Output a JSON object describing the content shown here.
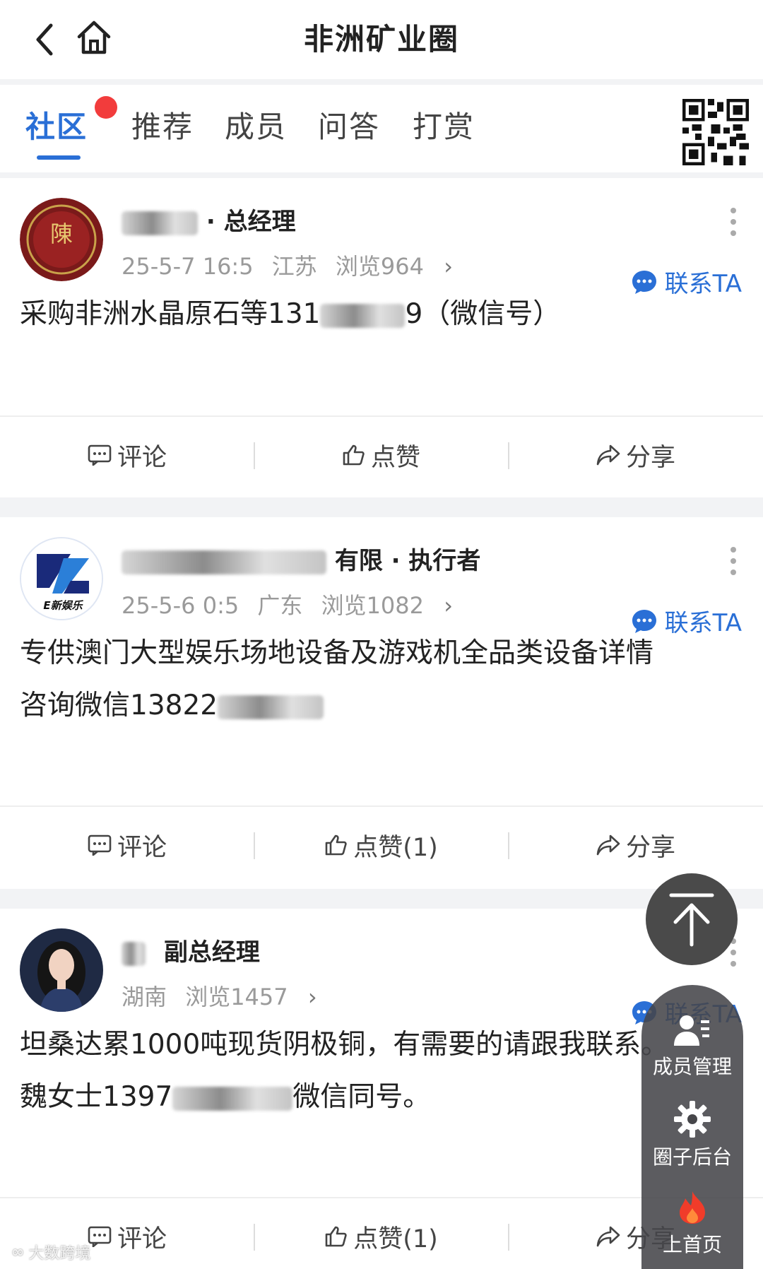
{
  "header": {
    "title": "非洲矿业圈"
  },
  "tabs": [
    {
      "label": "社区",
      "active": true
    },
    {
      "label": "推荐"
    },
    {
      "label": "成员"
    },
    {
      "label": "问答"
    },
    {
      "label": "打赏"
    }
  ],
  "posts": [
    {
      "author_role": "· 总经理",
      "meta_time": "25-5-7 16:5",
      "meta_location": "江苏",
      "meta_views": "浏览964",
      "contact_label": "联系TA",
      "content_prefix": "采购非洲水晶原石等131",
      "content_suffix": "9（微信号）",
      "actions": {
        "comment": "评论",
        "like": "点赞",
        "share": "分享"
      },
      "avatar_text": "陳"
    },
    {
      "author_role": "有限 · 执行者",
      "meta_time": "25-5-6 0:5",
      "meta_location": "广东",
      "meta_views": "浏览1082",
      "contact_label": "联系TA",
      "content_line1": "专供澳门大型娱乐场地设备及游戏机全品类设备详情",
      "content_line2_prefix": "咨询微信13822",
      "actions": {
        "comment": "评论",
        "like": "点赞(1)",
        "share": "分享"
      },
      "avatar_text": "E新娱乐"
    },
    {
      "author_role": "副总经理",
      "meta_location": "湖南",
      "meta_views": "浏览1457",
      "contact_label": "联系TA",
      "content_line1": "坦桑达累1000吨现货阴极铜，有需要的请跟我联系。",
      "content_line2_prefix": "魏女士1397",
      "content_line2_suffix": "微信同号。",
      "actions": {
        "comment": "评论",
        "like": "点赞(1)",
        "share": "分享"
      }
    }
  ],
  "float_panel": {
    "member_manage": "成员管理",
    "circle_admin": "圈子后台",
    "homepage": "上首页"
  },
  "watermark": {
    "text": "大数跨境"
  },
  "colors": {
    "accent": "#2a6fd6",
    "badge": "#f23c3c",
    "panel": "#46464a"
  }
}
